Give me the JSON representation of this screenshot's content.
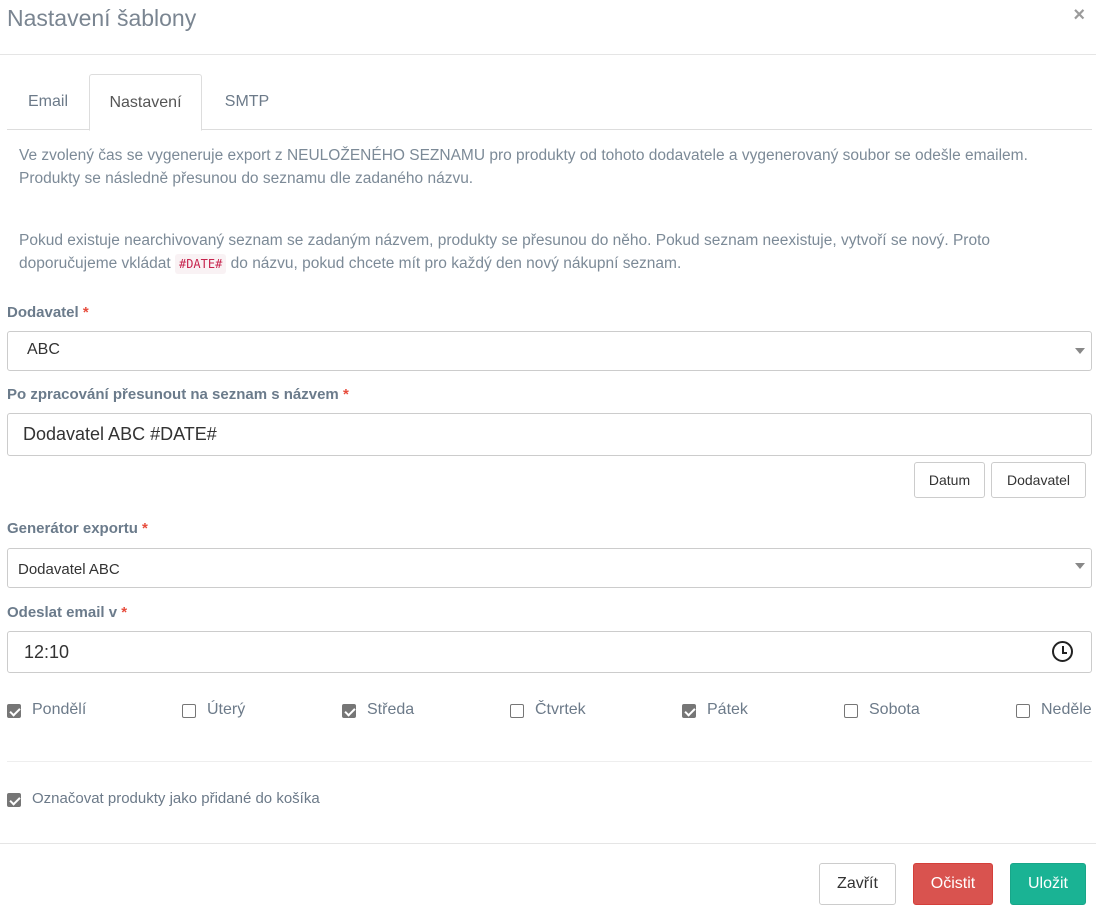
{
  "modal": {
    "title": "Nastavení šablony",
    "close_symbol": "×"
  },
  "tabs": [
    {
      "label": "Email",
      "active": false
    },
    {
      "label": "Nastavení",
      "active": true
    },
    {
      "label": "SMTP",
      "active": false
    }
  ],
  "description": {
    "p1": "Ve zvolený čas se vygeneruje export z NEULOŽENÉHO SEZNAMU pro produkty od tohoto dodavatele a vygenerovaný soubor se odešle emailem.",
    "p1_line2": "Produkty se následně přesunou do seznamu dle zadaného názvu.",
    "p2_line1": "Pokud existuje nearchivovaný seznam se zadaným názvem, produkty se přesunou do něho. Pokud seznam neexistuje, vytvoří se nový. Proto",
    "p2_line2_before": "doporučujeme vkládat",
    "p2_code": "#DATE#",
    "p2_line2_after": "do názvu, pokud chcete mít pro každý den nový nákupní seznam."
  },
  "form": {
    "supplier": {
      "label": "Dodavatel",
      "required": "*",
      "value": "ABC"
    },
    "list_name": {
      "label": "Po zpracování přesunout na seznam s názvem",
      "required": "*",
      "value": "Dodavatel ABC #DATE#"
    },
    "insert_buttons": {
      "date": "Datum",
      "supplier": "Dodavatel"
    },
    "generator": {
      "label": "Generátor exportu",
      "required": "*",
      "value": "Dodavatel ABC"
    },
    "send_time": {
      "label": "Odeslat email v",
      "required": "*",
      "value": "12:10"
    },
    "days": [
      {
        "label": "Pondělí",
        "checked": true
      },
      {
        "label": "Úterý",
        "checked": false
      },
      {
        "label": "Středa",
        "checked": true
      },
      {
        "label": "Čtvrtek",
        "checked": false
      },
      {
        "label": "Pátek",
        "checked": true
      },
      {
        "label": "Sobota",
        "checked": false
      },
      {
        "label": "Neděle",
        "checked": false
      }
    ],
    "mark_in_cart": {
      "label": "Označovat produkty jako přidané do košíka",
      "checked": true
    }
  },
  "footer": {
    "close": "Zavřít",
    "clear": "Očistit",
    "save": "Uložit"
  },
  "colors": {
    "danger": "#d9534f",
    "success": "#1ab394"
  }
}
